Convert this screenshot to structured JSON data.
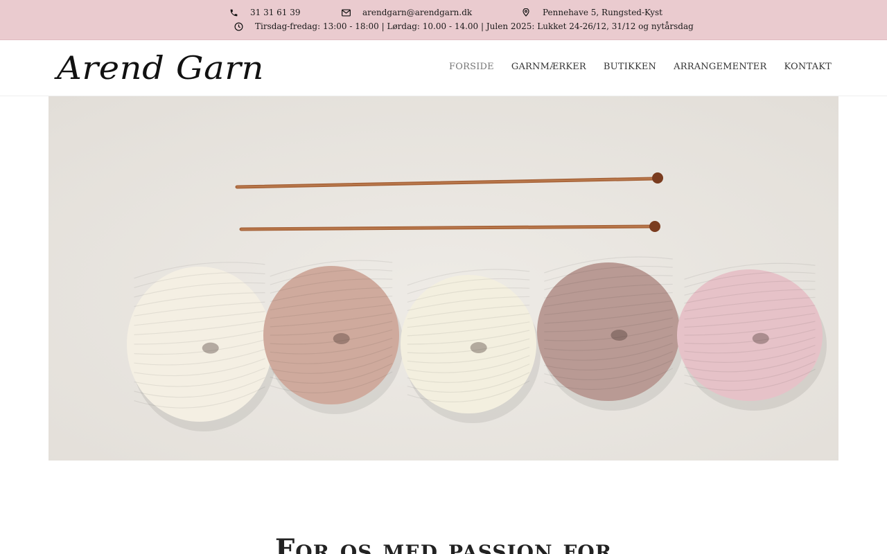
{
  "topbar": {
    "phone": "31 31 61 39",
    "email": "arendgarn@arendgarn.dk",
    "address": "Pennehave 5, Rungsted-Kyst",
    "hours": "Tirsdag-fredag: 13:00 - 18:00 | Lørdag: 10.00 - 14.00 | Julen 2025: Lukket 24-26/12, 31/12 og nytårsdag",
    "icons": {
      "phone": "phone-icon",
      "email": "envelope-icon",
      "address": "map-pin-icon",
      "hours": "clock-icon"
    },
    "bg_color": "#eacbcf"
  },
  "header": {
    "logo_text": "Arend Garn",
    "nav": [
      {
        "label": "FORSIDE",
        "active": true
      },
      {
        "label": "GARNMÆRKER",
        "active": false
      },
      {
        "label": "BUTIKKEN",
        "active": false
      },
      {
        "label": "ARRANGEMENTER",
        "active": false
      },
      {
        "label": "KONTAKT",
        "active": false
      }
    ]
  },
  "hero": {
    "yarn_colors": [
      "#f4efe3",
      "#cfaa9d",
      "#f3efdf",
      "#b99a94",
      "#e6c2c8"
    ],
    "needle_color": "#b0683a"
  },
  "main": {
    "headline": "For os med passion for"
  }
}
